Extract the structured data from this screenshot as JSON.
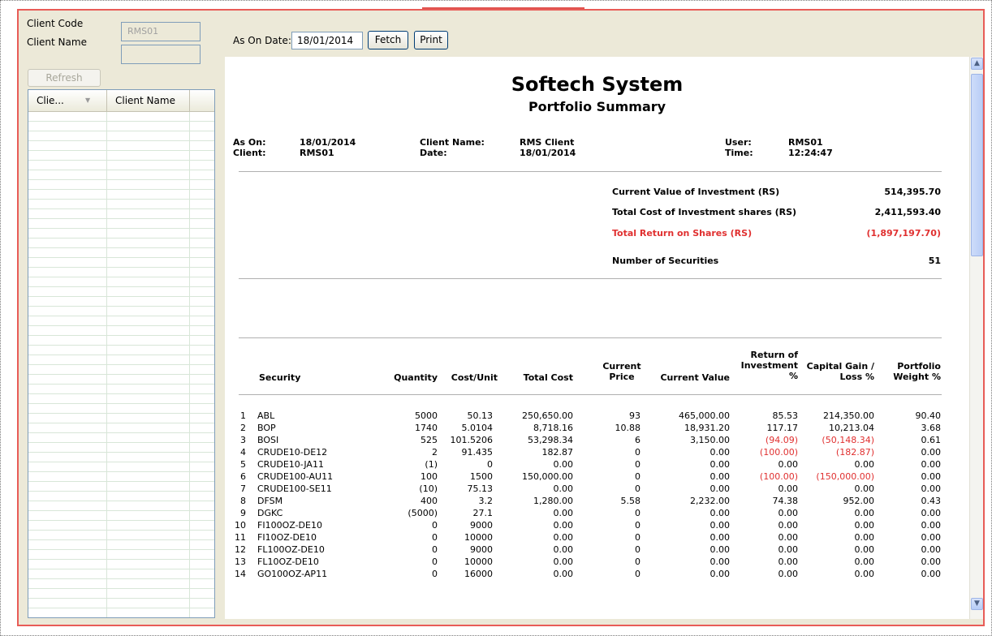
{
  "left_panel": {
    "client_code_label": "Client Code",
    "client_code_value": "RMS01",
    "client_name_label": "Client Name",
    "client_name_value": "",
    "refresh_label": "Refresh",
    "grid_columns": [
      "Clie...",
      "Client Name"
    ]
  },
  "toolbar": {
    "as_on_date_label": "As On Date:",
    "as_on_date_value": "18/01/2014",
    "fetch_label": "Fetch",
    "print_label": "Print"
  },
  "report": {
    "company": "Softech System",
    "title": "Portfolio Summary",
    "as_on_label": "As On:",
    "as_on_value": "18/01/2014",
    "client_label": "Client:",
    "client_value": "RMS01",
    "client_name_label": "Client Name:",
    "client_name_value": "RMS Client",
    "date_label": "Date:",
    "date_value": "18/01/2014",
    "user_label": "User:",
    "user_value": "RMS01",
    "time_label": "Time:",
    "time_value": "12:24:47",
    "summary": [
      {
        "label": "Current Value of Investment (RS)",
        "value": "514,395.70",
        "negative": false
      },
      {
        "label": "Total Cost of Investment shares (RS)",
        "value": "2,411,593.40",
        "negative": false
      },
      {
        "label": "Total Return on Shares (RS)",
        "value": "(1,897,197.70)",
        "negative": true
      },
      {
        "label": "Number of Securities",
        "value": "51",
        "negative": false
      }
    ],
    "columns": {
      "security": "Security",
      "quantity": "Quantity",
      "cost_unit": "Cost/Unit",
      "total_cost": "Total Cost",
      "current_price": "Current Price",
      "current_value": "Current Value",
      "return_of_investment": "Return of Investment %",
      "capital_gain": "Capital Gain / Loss %",
      "portfolio_weight": "Portfolio Weight %"
    },
    "rows": [
      {
        "no": "1",
        "security": "ABL",
        "quantity": "5000",
        "cost_unit": "50.13",
        "total_cost": "250,650.00",
        "price": "93",
        "value": "465,000.00",
        "roi": "85.53",
        "gain": "214,350.00",
        "weight": "90.40"
      },
      {
        "no": "2",
        "security": "BOP",
        "quantity": "1740",
        "cost_unit": "5.0104",
        "total_cost": "8,718.16",
        "price": "10.88",
        "value": "18,931.20",
        "roi": "117.17",
        "gain": "10,213.04",
        "weight": "3.68"
      },
      {
        "no": "3",
        "security": "BOSI",
        "quantity": "525",
        "cost_unit": "101.5206",
        "total_cost": "53,298.34",
        "price": "6",
        "value": "3,150.00",
        "roi": "(94.09)",
        "gain": "(50,148.34)",
        "weight": "0.61"
      },
      {
        "no": "4",
        "security": "CRUDE10-DE12",
        "quantity": "2",
        "cost_unit": "91.435",
        "total_cost": "182.87",
        "price": "0",
        "value": "0.00",
        "roi": "(100.00)",
        "gain": "(182.87)",
        "weight": "0.00"
      },
      {
        "no": "5",
        "security": "CRUDE10-JA11",
        "quantity": "(1)",
        "cost_unit": "0",
        "total_cost": "0.00",
        "price": "0",
        "value": "0.00",
        "roi": "0.00",
        "gain": "0.00",
        "weight": "0.00"
      },
      {
        "no": "6",
        "security": "CRUDE100-AU11",
        "quantity": "100",
        "cost_unit": "1500",
        "total_cost": "150,000.00",
        "price": "0",
        "value": "0.00",
        "roi": "(100.00)",
        "gain": "(150,000.00)",
        "weight": "0.00"
      },
      {
        "no": "7",
        "security": "CRUDE100-SE11",
        "quantity": "(10)",
        "cost_unit": "75.13",
        "total_cost": "0.00",
        "price": "0",
        "value": "0.00",
        "roi": "0.00",
        "gain": "0.00",
        "weight": "0.00"
      },
      {
        "no": "8",
        "security": "DFSM",
        "quantity": "400",
        "cost_unit": "3.2",
        "total_cost": "1,280.00",
        "price": "5.58",
        "value": "2,232.00",
        "roi": "74.38",
        "gain": "952.00",
        "weight": "0.43"
      },
      {
        "no": "9",
        "security": "DGKC",
        "quantity": "(5000)",
        "cost_unit": "27.1",
        "total_cost": "0.00",
        "price": "0",
        "value": "0.00",
        "roi": "0.00",
        "gain": "0.00",
        "weight": "0.00"
      },
      {
        "no": "10",
        "security": "FI100OZ-DE10",
        "quantity": "0",
        "cost_unit": "9000",
        "total_cost": "0.00",
        "price": "0",
        "value": "0.00",
        "roi": "0.00",
        "gain": "0.00",
        "weight": "0.00"
      },
      {
        "no": "11",
        "security": "FI10OZ-DE10",
        "quantity": "0",
        "cost_unit": "10000",
        "total_cost": "0.00",
        "price": "0",
        "value": "0.00",
        "roi": "0.00",
        "gain": "0.00",
        "weight": "0.00"
      },
      {
        "no": "12",
        "security": "FL100OZ-DE10",
        "quantity": "0",
        "cost_unit": "9000",
        "total_cost": "0.00",
        "price": "0",
        "value": "0.00",
        "roi": "0.00",
        "gain": "0.00",
        "weight": "0.00"
      },
      {
        "no": "13",
        "security": "FL10OZ-DE10",
        "quantity": "0",
        "cost_unit": "10000",
        "total_cost": "0.00",
        "price": "0",
        "value": "0.00",
        "roi": "0.00",
        "gain": "0.00",
        "weight": "0.00"
      },
      {
        "no": "14",
        "security": "GO100OZ-AP11",
        "quantity": "0",
        "cost_unit": "16000",
        "total_cost": "0.00",
        "price": "0",
        "value": "0.00",
        "roi": "0.00",
        "gain": "0.00",
        "weight": "0.00"
      }
    ]
  },
  "colors": {
    "frame_border": "#e85c57",
    "panel_bg": "#ece9d8",
    "negative_text": "#e03030"
  },
  "icons": {
    "scroll_up": "chevron-up-icon",
    "scroll_down": "chevron-down-icon",
    "sort": "sort-desc-icon"
  }
}
